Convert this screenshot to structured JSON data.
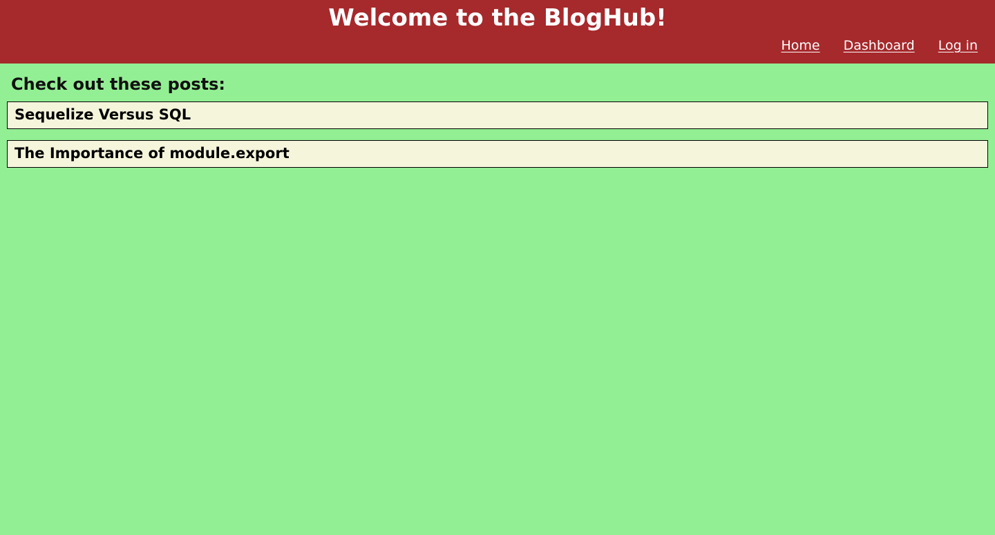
{
  "header": {
    "title": "Welcome to the BlogHub!",
    "nav": [
      {
        "label": "Home"
      },
      {
        "label": "Dashboard"
      },
      {
        "label": "Log in"
      }
    ]
  },
  "main": {
    "heading": "Check out these posts:",
    "posts": [
      {
        "title": "Sequelize Versus SQL"
      },
      {
        "title": "The Importance of module.export"
      }
    ]
  },
  "colors": {
    "header_background": "#a6292c",
    "page_background": "#93ef93",
    "card_background": "#f5f5dc"
  }
}
